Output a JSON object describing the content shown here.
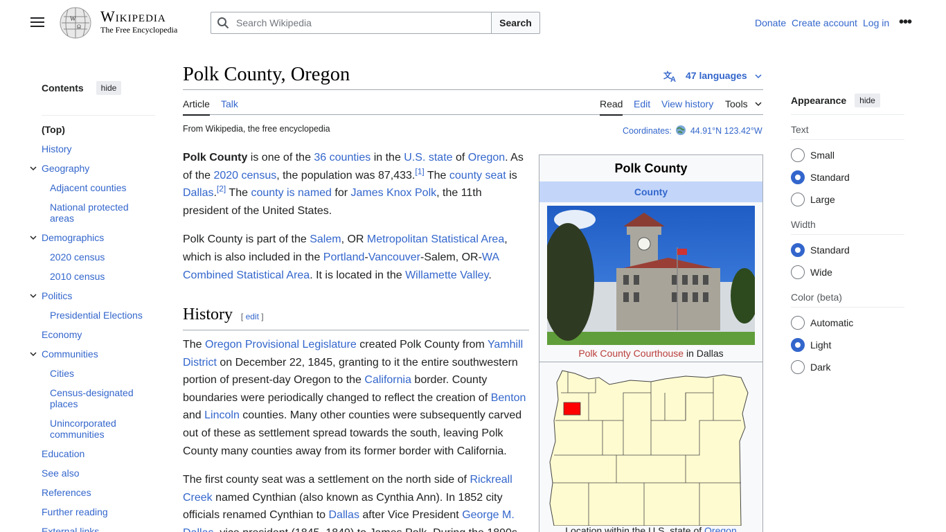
{
  "header": {
    "menu_icon": "hamburger-icon",
    "logo_title": "Wikipedia",
    "logo_subtitle": "The Free Encyclopedia",
    "search_placeholder": "Search Wikipedia",
    "search_button": "Search",
    "links": {
      "donate": "Donate",
      "create_account": "Create account",
      "login": "Log in"
    },
    "more_icon": "ellipsis-icon"
  },
  "toc": {
    "title": "Contents",
    "hide": "hide",
    "items": [
      "(Top)",
      "History",
      "Geography",
      "Adjacent counties",
      "National protected areas",
      "Demographics",
      "2020 census",
      "2010 census",
      "Politics",
      "Presidential Elections",
      "Economy",
      "Communities",
      "Cities",
      "Census-designated places",
      "Unincorporated communities",
      "Education",
      "See also",
      "References",
      "Further reading",
      "External links"
    ]
  },
  "page": {
    "title": "Polk County, Oregon",
    "languages": "47 languages",
    "tabs": {
      "article": "Article",
      "talk": "Talk",
      "read": "Read",
      "edit": "Edit",
      "history": "View history",
      "tools": "Tools"
    },
    "from": "From Wikipedia, the free encyclopedia",
    "coords_label": "Coordinates:",
    "coords_value": "44.91°N 123.42°W",
    "history_heading": "History",
    "edit_link": "edit"
  },
  "infobox": {
    "title": "Polk County",
    "subtitle": "County",
    "photo_caption_link": "Polk County Courthouse",
    "photo_caption_rest": " in Dallas",
    "map_caption_text": "Location within the U.S. state of ",
    "map_caption_link": "Oregon"
  },
  "appearance": {
    "title": "Appearance",
    "hide": "hide",
    "text_label": "Text",
    "text_options": [
      "Small",
      "Standard",
      "Large"
    ],
    "text_selected": "Standard",
    "width_label": "Width",
    "width_options": [
      "Standard",
      "Wide"
    ],
    "width_selected": "Standard",
    "color_label": "Color (beta)",
    "color_options": [
      "Automatic",
      "Light",
      "Dark"
    ],
    "color_selected": "Light"
  },
  "colors": {
    "link": "#3366cc",
    "red_link": "#ba3e3b",
    "county_highlight": "#ff0000",
    "map_fill": "#fffbd0"
  }
}
